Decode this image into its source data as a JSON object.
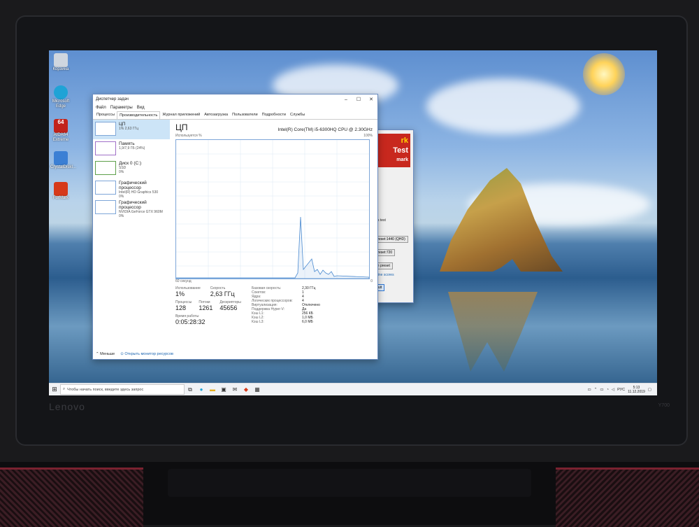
{
  "device": {
    "brand": "Lenovo",
    "model": "Y700"
  },
  "desktop_icons": [
    {
      "label": "Корзина",
      "icon": "recycle-bin-icon",
      "color": "#cfd6df"
    },
    {
      "label": "Microsoft Edge",
      "icon": "edge-icon",
      "color": "#1fa3d6"
    },
    {
      "label": "AIDA64 Extreme",
      "icon": "aida64-icon",
      "color": "#c2231b"
    },
    {
      "label": "CrystalDiskI...",
      "icon": "crystaldisk-icon",
      "color": "#3b7fd4"
    },
    {
      "label": "FurMark",
      "icon": "furmark-icon",
      "color": "#d63a1a"
    }
  ],
  "task_manager": {
    "title": "Диспетчер задач",
    "menu": [
      "Файл",
      "Параметры",
      "Вид"
    ],
    "tabs": [
      "Процессы",
      "Производительность",
      "Журнал приложений",
      "Автозагрузка",
      "Пользователи",
      "Подробности",
      "Службы"
    ],
    "active_tab": "Производительность",
    "sidebar": [
      {
        "title": "ЦП",
        "sub": "1% 2,63 ГГц",
        "selected": true
      },
      {
        "title": "Память",
        "sub": "1,9/7,9 ГБ (24%)"
      },
      {
        "title": "Диск 0 (C:)",
        "sub": "SSD",
        "sub2": "0%"
      },
      {
        "title": "Графический процессор",
        "sub": "Intel(R) HD Graphics 530",
        "sub2": "0%"
      },
      {
        "title": "Графический процессор",
        "sub": "NVIDIA GeForce GTX 960M",
        "sub2": "0%"
      }
    ],
    "heading": "ЦП",
    "cpu_name": "Intel(R) Core(TM) i5-6300HQ CPU @ 2.30GHz",
    "graph_label_left": "Используется %",
    "graph_label_right": "100%",
    "graph_bottom_left": "60 секунд",
    "graph_bottom_right": "0",
    "stats": {
      "usage_label": "Использование",
      "usage": "1%",
      "speed_label": "Скорость",
      "speed": "2,63 ГГц",
      "processes_label": "Процессы",
      "processes": "128",
      "threads_label": "Потоки",
      "threads": "1261",
      "handles_label": "Дескрипторы",
      "handles": "45656",
      "uptime_label": "Время работы",
      "uptime": "0:05:28:32"
    },
    "details": [
      {
        "k": "Базовая скорость:",
        "v": "2,30 ГГц"
      },
      {
        "k": "Сокетов:",
        "v": "1"
      },
      {
        "k": "Ядра:",
        "v": "4"
      },
      {
        "k": "Логических процессоров:",
        "v": "4"
      },
      {
        "k": "Виртуализация:",
        "v": "Отключено"
      },
      {
        "k": "Поддержка Hyper-V:",
        "v": "Да"
      },
      {
        "k": "Кэш L1:",
        "v": "256 КБ"
      },
      {
        "k": "Кэш L2:",
        "v": "1,0 МБ"
      },
      {
        "k": "Кэш L3:",
        "v": "6,0 МБ"
      }
    ],
    "footer_less": "Меньше",
    "footer_monitor": "Открыть монитор ресурсов"
  },
  "furmark": {
    "logo_line1": "rk",
    "logo_line2": "Test",
    "logo_line3": "mark",
    "row1": "ress test",
    "row2": "ks",
    "preset1": "Preset:1440 (QHD)",
    "preset2": "Preset:720",
    "preset3": "en preset",
    "online": "Online scores",
    "quit": "Quit"
  },
  "taskbar": {
    "search_placeholder": "Чтобы начать поиск, введите здесь запрос",
    "lang": "РУС",
    "time": "5:13",
    "date": "11.12.2019"
  }
}
